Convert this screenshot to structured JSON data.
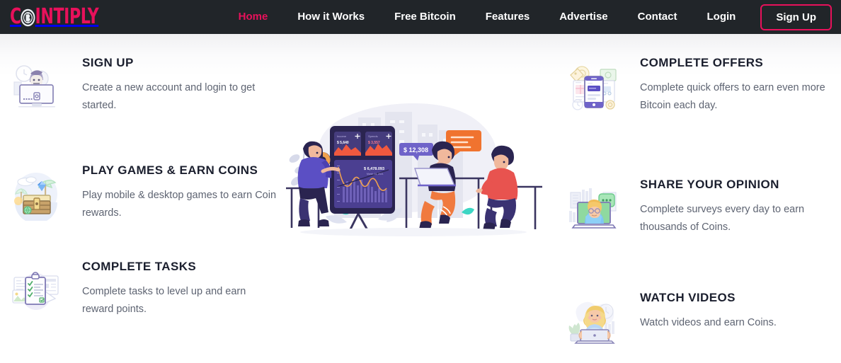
{
  "brand": {
    "name_prefix": "C",
    "name_suffix": "INTIPLY",
    "coin_icon": "bitcoin-coin-icon",
    "color": "#e8115b"
  },
  "nav": {
    "items": [
      {
        "label": "Home",
        "active": true
      },
      {
        "label": "How it Works",
        "active": false
      },
      {
        "label": "Free Bitcoin",
        "active": false
      },
      {
        "label": "Features",
        "active": false
      },
      {
        "label": "Advertise",
        "active": false
      },
      {
        "label": "Contact",
        "active": false
      },
      {
        "label": "Login",
        "active": false
      }
    ],
    "signup_label": "Sign Up",
    "background": "#212529",
    "active_color": "#e8115b"
  },
  "features_left": [
    {
      "title": "SIGN UP",
      "desc": "Create a new account and login to get started.",
      "icon": "person-at-desktop-computer-icon"
    },
    {
      "title": "PLAY GAMES & EARN COINS",
      "desc": "Play mobile & desktop games to earn Coin rewards.",
      "icon": "treasure-chest-icon"
    },
    {
      "title": "COMPLETE TASKS",
      "desc": "Complete tasks to level up and earn reward points.",
      "icon": "clipboard-checklist-icon"
    }
  ],
  "features_right": [
    {
      "title": "COMPLETE OFFERS",
      "desc": "Complete quick offers to earn even more Bitcoin each day.",
      "icon": "mobile-offers-icon"
    },
    {
      "title": "SHARE YOUR OPINION",
      "desc": "Complete surveys every day to earn thousands of Coins.",
      "icon": "survey-person-laptop-icon"
    },
    {
      "title": "WATCH VIDEOS",
      "desc": "Watch videos and earn Coins.",
      "icon": "woman-with-laptop-icon"
    }
  ],
  "hero": {
    "illustration": "people-with-trading-dashboard-illustration",
    "price_badge": "$ 12,308",
    "dashboard": {
      "card1_label": "Income",
      "card1_value": "$ 5,640",
      "card2_label": "Spends",
      "card2_value": "$ 3,557",
      "chart_value": "$ 6,478.093",
      "chart_date": "March 14, 2021"
    }
  },
  "colors": {
    "heading": "#1b1f2e",
    "body_text": "#5e6472",
    "nav_bg": "#212529",
    "accent": "#e8115b"
  }
}
